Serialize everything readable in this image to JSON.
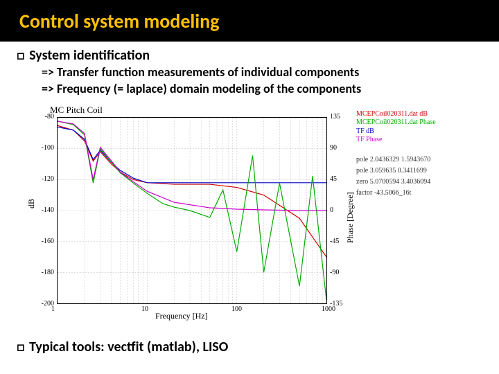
{
  "title": "Control system modeling",
  "bullet1": "System identification",
  "sub1": "=> Transfer function measurements of individual components",
  "sub2": "=> Frequency (= laplace) domain modeling of the components",
  "bullet2": "Typical tools: vectfit (matlab), LISO",
  "chart_data": {
    "type": "line",
    "title": "MC Pitch Coil",
    "xlabel": "Frequency [Hz]",
    "ylabel_left": "dB",
    "ylabel_right": "Phase [Degree]",
    "x_scale": "log",
    "xlim": [
      1,
      1000
    ],
    "ylim_left": [
      -200,
      -80
    ],
    "ylim_right": [
      -135,
      135
    ],
    "xticks": [
      1,
      10,
      100,
      1000
    ],
    "yticks_left": [
      -80,
      -100,
      -120,
      -140,
      -160,
      -180,
      -200
    ],
    "yticks_right": [
      135,
      90,
      45,
      0,
      -45,
      -90,
      -135
    ],
    "legend": [
      {
        "label": "MCEPCoil020311.dat dB",
        "color": "#cc0000"
      },
      {
        "label": "MCEPCoil020311.dat Phase",
        "color": "#00aa00"
      },
      {
        "label": "TF dB",
        "color": "#0000cc"
      },
      {
        "label": "TF Phase",
        "color": "#cc00cc"
      }
    ],
    "fit_params": [
      "pole 2.0436329 1.5943670",
      "pole 3.059635 0.3411699",
      "zero 5.0700594 3.4036094",
      "factor -43.5066_16t"
    ],
    "series": [
      {
        "name": "meas_dB",
        "axis": "left",
        "color": "#cc0000",
        "x": [
          1,
          1.5,
          2,
          2.5,
          3,
          4,
          5,
          7,
          10,
          20,
          50,
          100,
          200,
          500,
          1000
        ],
        "values": [
          -85,
          -88,
          -95,
          -108,
          -102,
          -110,
          -115,
          -120,
          -122,
          -123,
          -123,
          -125,
          -130,
          -145,
          -170
        ]
      },
      {
        "name": "tf_dB",
        "axis": "left",
        "color": "#0000cc",
        "x": [
          1,
          1.5,
          2,
          2.5,
          3,
          4,
          5,
          7,
          10,
          20,
          50,
          100,
          200,
          500,
          1000
        ],
        "values": [
          -86,
          -88,
          -94,
          -107,
          -101,
          -109,
          -114,
          -119,
          -122,
          -122,
          -122,
          -122,
          -122,
          -122,
          -122
        ]
      },
      {
        "name": "meas_phase",
        "axis": "right",
        "color": "#00aa00",
        "x": [
          1,
          1.5,
          2,
          2.5,
          3,
          4,
          5,
          7,
          10,
          15,
          20,
          30,
          50,
          70,
          100,
          150,
          200,
          300,
          500,
          700,
          1000
        ],
        "values": [
          130,
          125,
          110,
          40,
          90,
          70,
          55,
          40,
          25,
          10,
          5,
          0,
          -10,
          30,
          -60,
          80,
          -90,
          40,
          -110,
          50,
          -130
        ]
      },
      {
        "name": "tf_phase",
        "axis": "right",
        "color": "#cc00cc",
        "x": [
          1,
          1.5,
          2,
          2.5,
          3,
          4,
          5,
          7,
          10,
          20,
          50,
          100,
          200,
          500,
          1000
        ],
        "values": [
          130,
          126,
          112,
          45,
          92,
          72,
          56,
          42,
          28,
          12,
          4,
          2,
          1,
          0,
          0
        ]
      }
    ]
  }
}
